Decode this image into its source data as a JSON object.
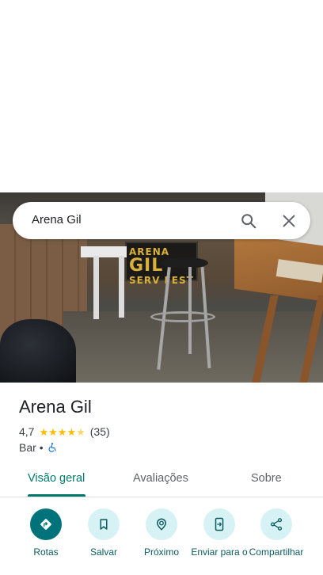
{
  "search": {
    "query": "Arena Gil"
  },
  "photo": {
    "banner_line1": "ARENA",
    "banner_line2": "GIL",
    "banner_line3": "SERV FEST"
  },
  "place": {
    "title": "Arena Gil",
    "rating": "4,7",
    "stars": 4.7,
    "review_count": "(35)",
    "category": "Bar",
    "separator": "•"
  },
  "tabs": [
    {
      "label": "Visão geral",
      "active": true
    },
    {
      "label": "Avaliações",
      "active": false
    },
    {
      "label": "Sobre",
      "active": false
    }
  ],
  "actions": [
    {
      "label": "Rotas",
      "icon": "directions-icon"
    },
    {
      "label": "Salvar",
      "icon": "bookmark-icon"
    },
    {
      "label": "Próximo",
      "icon": "nearby-icon"
    },
    {
      "label": "Enviar para o",
      "icon": "send-to-phone-icon"
    },
    {
      "label": "Compartilhar",
      "icon": "share-icon"
    }
  ],
  "colors": {
    "accent": "#00796b",
    "primary_action": "#00737a",
    "secondary_action_bg": "#d6f2f5",
    "star": "#fbbc04"
  }
}
